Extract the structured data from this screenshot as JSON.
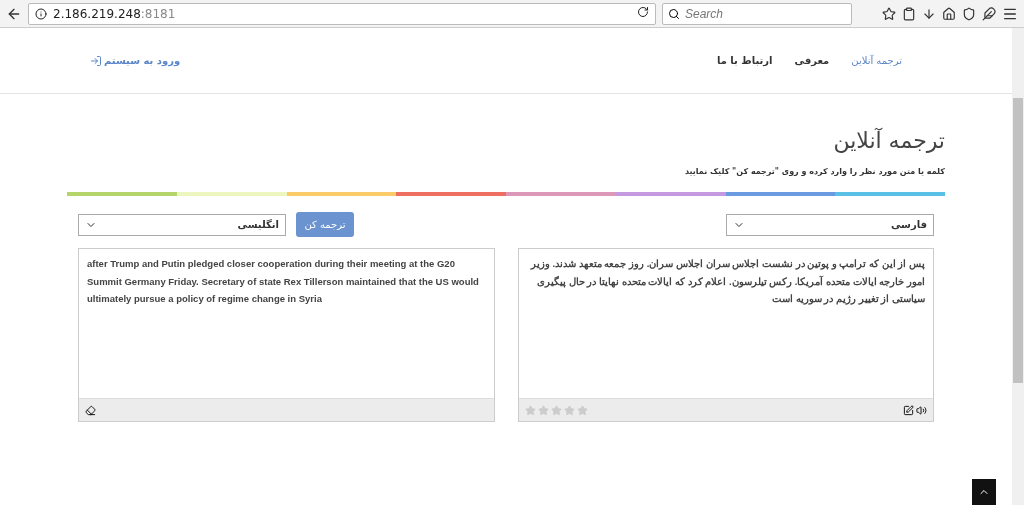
{
  "browser": {
    "host": "2.186.219.248",
    "port": ":8181",
    "search": {
      "placeholder": "Search"
    }
  },
  "nav": {
    "items": [
      {
        "label": "ترجمه آنلاین",
        "selected": true
      },
      {
        "label": "معرفی",
        "selected": false
      },
      {
        "label": "ارتباط با ما",
        "selected": false
      }
    ],
    "login": "ورود به سیستم"
  },
  "title": "ترجمه آنلاین",
  "instruction": "کلمه یا متن مورد نظر را وارد کرده و روی \"ترجمه کن\" کلیک نمایید",
  "color_bar": [
    {
      "color": "#b5d56a"
    },
    {
      "color": "#eef6c0"
    },
    {
      "color": "#fbcb6a"
    },
    {
      "color": "#ee6e62"
    },
    {
      "color": "#dc98b8"
    },
    {
      "color": "#c599df"
    },
    {
      "color": "#6a9be0"
    },
    {
      "color": "#5bc0e6"
    }
  ],
  "source": {
    "language": "فارسی",
    "text": "پس از این که ترامپ و پوتین در نشست اجلاس سران اجلاس سران. روز جمعه متعهد شدند. وزیر امور خارجه ایالات متحده آمریکا. رکس تیلرسون. اعلام کرد که ایالات متحده نهایتا در حال پیگیری سیاستی از تغییر رژیم در سوریه است",
    "stars": 0
  },
  "translate_button": "ترجمه کن",
  "target": {
    "language": "انگلیسی",
    "text": "after Trump and Putin pledged closer cooperation during their meeting at the G20 Summit Germany Friday. Secretary of state Rex Tillerson maintained that the US would ultimately pursue a policy of regime change in Syria"
  }
}
